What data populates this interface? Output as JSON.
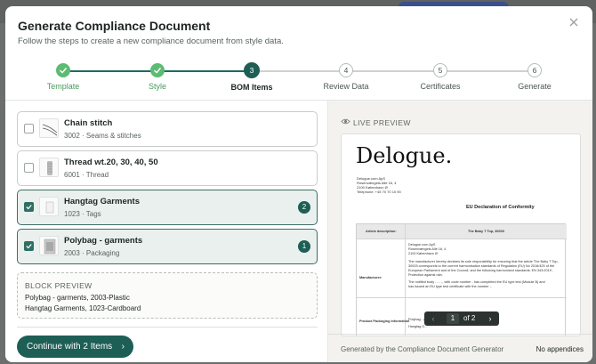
{
  "modal": {
    "title": "Generate Compliance Document",
    "subtitle": "Follow the steps to create a new compliance document from style data."
  },
  "stepper": {
    "steps": [
      {
        "number": "1",
        "label": "Template",
        "state": "done"
      },
      {
        "number": "2",
        "label": "Style",
        "state": "done"
      },
      {
        "number": "3",
        "label": "BOM Items",
        "state": "active"
      },
      {
        "number": "4",
        "label": "Review Data",
        "state": "pending"
      },
      {
        "number": "5",
        "label": "Certificates",
        "state": "pending"
      },
      {
        "number": "6",
        "label": "Generate",
        "state": "pending"
      }
    ]
  },
  "bom_items": [
    {
      "title": "Chain stitch",
      "subtitle": "3002 · Seams & stitches",
      "selected": false,
      "order": ""
    },
    {
      "title": "Thread wt.20, 30, 40, 50",
      "subtitle": "6001 · Thread",
      "selected": false,
      "order": ""
    },
    {
      "title": "Hangtag Garments",
      "subtitle": "1023 · Tags",
      "selected": true,
      "order": "2"
    },
    {
      "title": "Polybag - garments",
      "subtitle": "2003 · Packaging",
      "selected": true,
      "order": "1"
    }
  ],
  "block_preview": {
    "title": "BLOCK PREVIEW",
    "lines": [
      "Polybag - garments, 2003-Plastic",
      "Hangtag Garments, 1023-Cardboard"
    ]
  },
  "continue_button": {
    "label": "Continue with 2 Items",
    "chevron": "›"
  },
  "live_preview": {
    "header": "LIVE PREVIEW",
    "document": {
      "logo": "Delogue.",
      "address_lines": [
        "Delogue.com ApS",
        "Rosenvængets Allé 16, 4",
        "2100 København Ø",
        "Telephone: +45 70 70 10 90"
      ],
      "heading": "EU Declaration of Conformity",
      "article_label": "Article description:",
      "article_value": "The Baby T Top, 30003",
      "manufacturer_label": "Manufacturer:",
      "manufacturer_lines": [
        "Delogue.com ApS",
        "Rosenvængets Allé 16, 4",
        "2100 København Ø"
      ],
      "manufacturer_text": [
        "The manufacturer hereby declares its sole responsibility for ensuring that the article The Baby T Top,",
        "30003 corresponds to the current harmonisation standards of Regulation (EU) No 2016/425 of the",
        "European Parliament and of the Council, and the following harmonised standards: EN 343:2019 -",
        "Protection against rain.",
        "The notified body - - - -, with code number - has completed the EU type test (Module B) and",
        "has issued an EU type test certificate with the number -."
      ],
      "packaging_label": "Product Packaging Information",
      "packaging_lines": [
        "Polybag - g...",
        "Hangtag G..."
      ]
    },
    "pager": {
      "prev": "‹",
      "page": "1",
      "of_text": "of 2",
      "next": "›"
    },
    "footer_left": "Generated by the Compliance Document Generator",
    "footer_right": "No appendices"
  },
  "colors": {
    "accent": "#1d5e55",
    "success": "#5dbb73"
  }
}
